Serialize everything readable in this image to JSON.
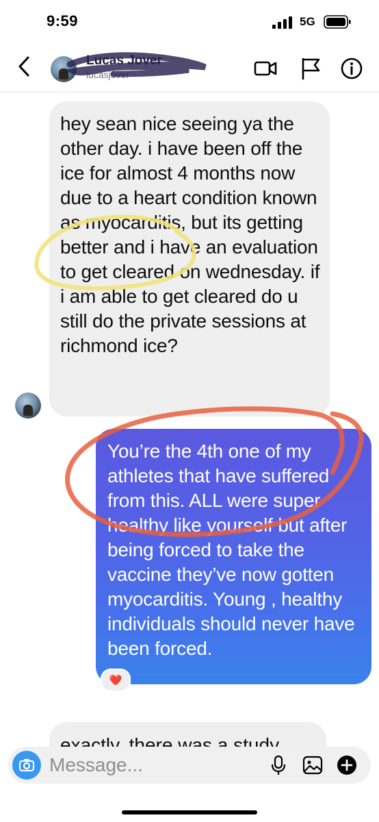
{
  "status_bar": {
    "time": "9:59",
    "network": "5G"
  },
  "header": {
    "contact_name": "Lucas Jover",
    "username": "lucasjover",
    "icons": [
      "back-chevron-icon",
      "video-camera-icon",
      "flag-icon",
      "info-icon"
    ]
  },
  "messages": [
    {
      "direction": "incoming",
      "text": "hey sean nice seeing ya the other day. i have been off the ice for almost 4 months now due to a heart condition known as myocarditis, but its getting better and i have an evaluation to get cleared on wednesday. if i am able to get cleared do u still do the private sessions at richmond ice?"
    },
    {
      "direction": "outgoing",
      "text": "You’re the 4th one of my athletes that have suffered from this. ALL were super healthy like yourself but after being forced to take the vaccine they’ve now gotten myocarditis. Young , healthy individuals should never have been forced.",
      "reaction": "❤️"
    },
    {
      "direction": "incoming",
      "text": "exactly, there was a study"
    }
  ],
  "composer": {
    "placeholder": "Message..."
  },
  "colors": {
    "outgoing_bubble_top": "#5b59df",
    "outgoing_bubble_bottom": "#3a82ea",
    "incoming_bubble": "#efefef",
    "camera_button": "#3897f0",
    "annotation_yellow": "#f3e27a",
    "annotation_red": "#e8603f"
  }
}
